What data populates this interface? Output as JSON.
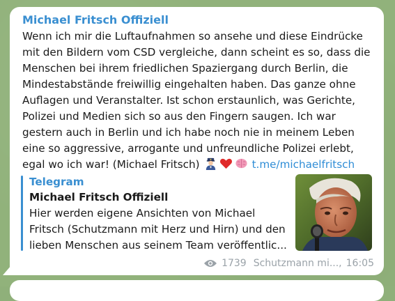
{
  "post": {
    "channel_name": "Michael Fritsch Offiziell",
    "text_lines": [
      "Wenn ich mir die Luftaufnahmen so ansehe und diese Eindrücke",
      "mit den Bildern vom CSD vergleiche, dann scheint es so, dass die",
      "Menschen bei ihrem friedlichen Spaziergang durch Berlin, die",
      "Mindestabstände freiwillig eingehalten haben. Das ganze ohne",
      "Auflagen und Veranstalter. Ist schon erstaunlich, was Gerichte,",
      "Polizei und Medien sich so aus den Fingern saugen. Ich war",
      "gestern auch in Berlin und ich habe noch nie in meinem Leben",
      "eine so aggressive, arrogante und unfreundliche Polizei erlebt,",
      "egal wo ich war! (Michael Fritsch)"
    ],
    "emojis": [
      "police-officer-emoji",
      "red-heart-emoji",
      "brain-emoji"
    ],
    "link_text": "t.me/michaelfritsch"
  },
  "preview": {
    "site_name": "Telegram",
    "title": "Michael Fritsch Offiziell",
    "description_lines": [
      "Hier werden eigene Ansichten von Michael",
      "Fritsch (Schutzmann mit Herz und Hirn) und den",
      "lieben Menschen aus seinem Team veröffentlic..."
    ],
    "thumbnail": "man-with-microphone-photo"
  },
  "footer": {
    "views": "1739",
    "author": "Schutzmann mi...,",
    "time": "16:05"
  },
  "colors": {
    "accent": "#3a8fd1",
    "link": "#2f8dd6",
    "meta": "#9aa2a8",
    "background": "#91b27b"
  }
}
